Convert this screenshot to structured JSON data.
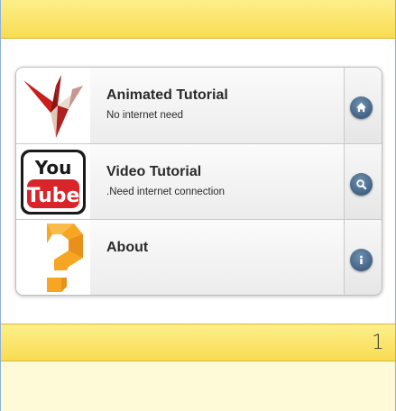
{
  "header": {
    "title": ""
  },
  "menu": {
    "items": [
      {
        "title": "Animated Tutorial",
        "subtitle": "No internet need",
        "thumb_icon": "origami-crane-icon",
        "action_icon": "home-icon"
      },
      {
        "title": "Video Tutorial",
        "subtitle": ".Need internet connection",
        "thumb_icon": "youtube-logo-icon",
        "action_icon": "search-icon"
      },
      {
        "title": "About",
        "subtitle": "",
        "thumb_icon": "question-mark-icon",
        "action_icon": "info-icon"
      }
    ]
  },
  "footer_bar": {
    "page_number": "1"
  },
  "colors": {
    "bar_yellow": "#f8dc52",
    "button_blue": "#3d5f84",
    "youtube_red": "#d9252a",
    "question_orange": "#f6a623"
  }
}
